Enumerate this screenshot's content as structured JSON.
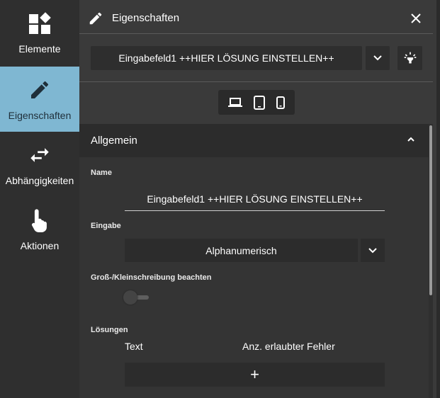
{
  "sidebar": {
    "items": [
      {
        "label": "Elemente",
        "icon": "widgets-icon"
      },
      {
        "label": "Eigenschaften",
        "icon": "pencil-icon"
      },
      {
        "label": "Abhängigkeiten",
        "icon": "swap-arrows-icon"
      },
      {
        "label": "Aktionen",
        "icon": "touch-hand-icon"
      }
    ],
    "active_index": 1
  },
  "panel": {
    "title": "Eigenschaften",
    "element_select": "Eingabefeld1 ++HIER LÖSUNG EINSTELLEN++",
    "devices": [
      "laptop-icon",
      "tablet-icon",
      "phone-icon"
    ]
  },
  "section": {
    "title": "Allgemein",
    "name_label": "Name",
    "name_value": "Eingabefeld1 ++HIER LÖSUNG EINSTELLEN++",
    "eingabe_label": "Eingabe",
    "eingabe_value": "Alphanumerisch",
    "case_label": "Groß-/Kleinschreibung beachten",
    "case_sensitive": false,
    "loesungen_label": "Lösungen",
    "col_text": "Text",
    "col_errors": "Anz. erlaubter Fehler",
    "add_label": "+"
  },
  "colors": {
    "active_sidebar": "#7fb7d2",
    "panel_bg": "#3a3a3a",
    "section_bg": "#343434"
  }
}
